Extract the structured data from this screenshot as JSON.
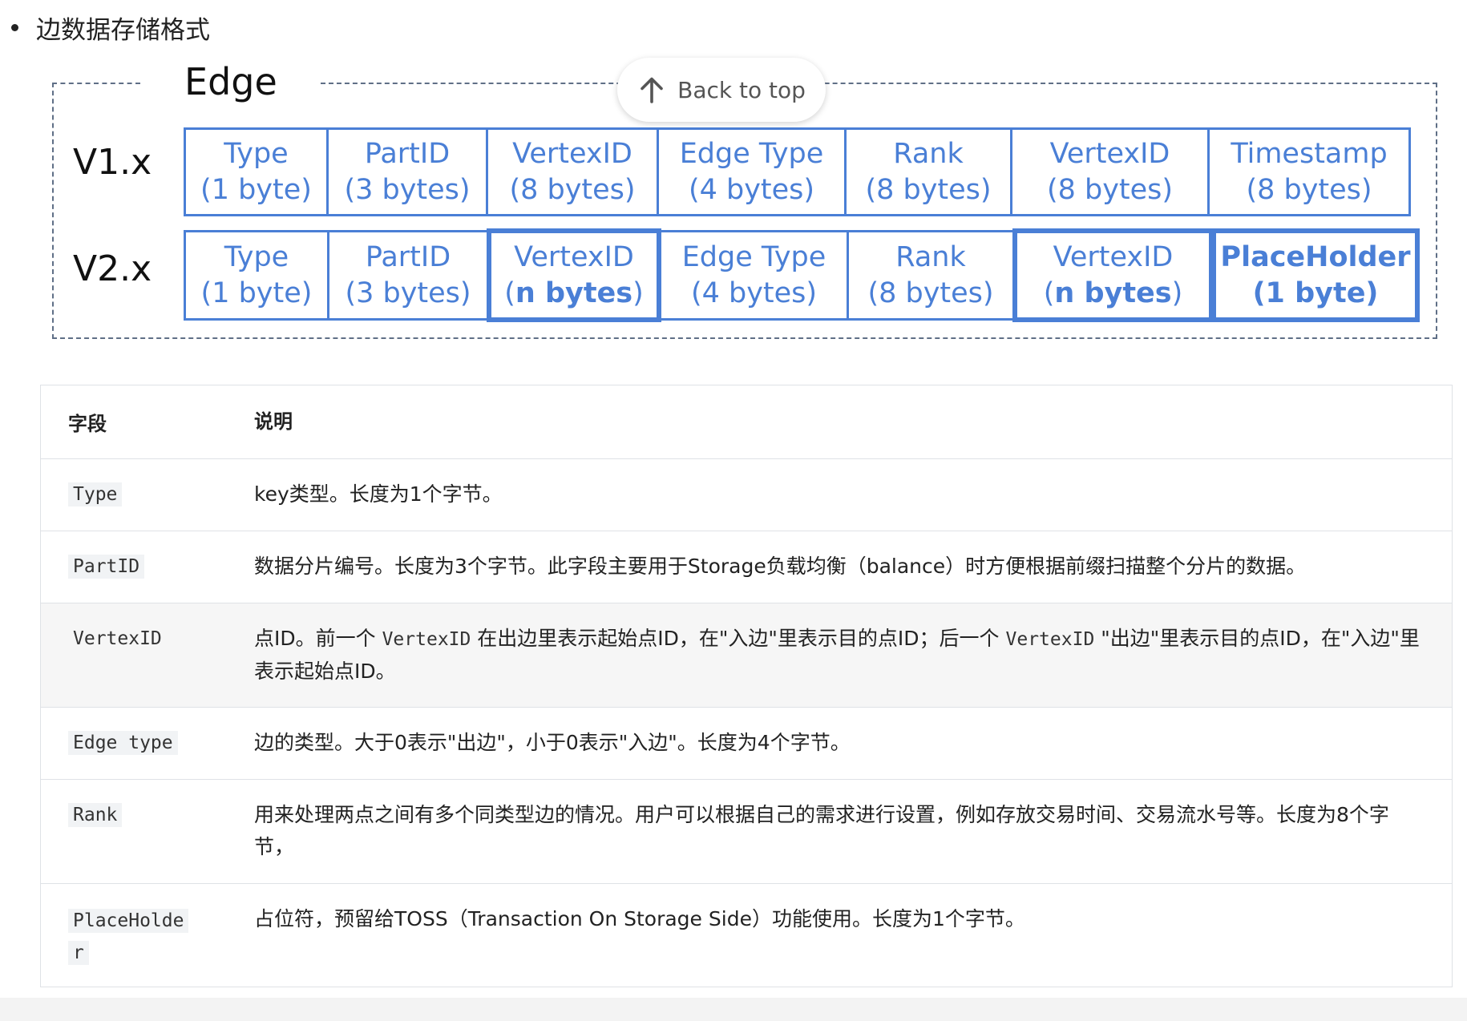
{
  "heading": "边数据存储格式",
  "diagram": {
    "title": "Edge",
    "v1_label": "V1.x",
    "v2_label": "V2.x",
    "v1_cells": [
      {
        "name": "Type",
        "size": "(1 byte)"
      },
      {
        "name": "PartID",
        "size": "(3 bytes)"
      },
      {
        "name": "VertexID",
        "size": "(8 bytes)"
      },
      {
        "name": "Edge Type",
        "size": "(4 bytes)"
      },
      {
        "name": "Rank",
        "size": "(8 bytes)"
      },
      {
        "name": "VertexID",
        "size": "(8 bytes)"
      },
      {
        "name": "Timestamp",
        "size": "(8 bytes)"
      }
    ],
    "v2_cells": [
      {
        "name": "Type",
        "size": "(1 byte)"
      },
      {
        "name": "PartID",
        "size": "(3 bytes)"
      },
      {
        "name": "VertexID",
        "size_open": "(",
        "size_bold": "n bytes",
        "size_close": ")"
      },
      {
        "name": "Edge Type",
        "size": "(4 bytes)"
      },
      {
        "name": "Rank",
        "size": "(8 bytes)"
      },
      {
        "name": "VertexID",
        "size_open": "(",
        "size_bold": "n bytes",
        "size_close": ")"
      },
      {
        "name": "PlaceHolder",
        "size": "(1 byte)"
      }
    ]
  },
  "back_to_top": "Back to top",
  "table": {
    "headers": [
      "字段",
      "说明"
    ],
    "rows": [
      {
        "field": "Type",
        "desc": "key类型。长度为1个字节。"
      },
      {
        "field": "PartID",
        "desc": "数据分片编号。长度为3个字节。此字段主要用于Storage负载均衡（balance）时方便根据前缀扫描整个分片的数据。"
      },
      {
        "field": "VertexID",
        "desc_a": "点ID。前一个 ",
        "code_a": "VertexID",
        "desc_b": " 在出边里表示起始点ID，在\"入边\"里表示目的点ID；后一个 ",
        "code_b": "VertexID",
        "desc_c": " \"出边\"里表示目的点ID，在\"入边\"里表示起始点ID。"
      },
      {
        "field": "Edge type",
        "desc": "边的类型。大于0表示\"出边\"，小于0表示\"入边\"。长度为4个字节。"
      },
      {
        "field": "Rank",
        "desc": "用来处理两点之间有多个同类型边的情况。用户可以根据自己的需求进行设置，例如存放交易时间、交易流水号等。长度为8个字节，"
      },
      {
        "field_line1": "PlaceHolde",
        "field_line2": "r",
        "desc": "占位符，预留给TOSS（Transaction On Storage Side）功能使用。长度为1个字节。"
      }
    ]
  }
}
